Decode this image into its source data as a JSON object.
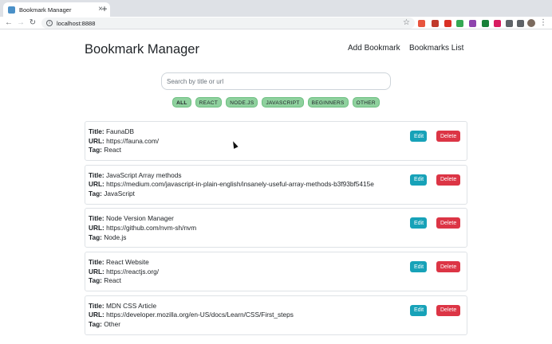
{
  "browser": {
    "tab_title": "Bookmark Manager",
    "tab_close": "×",
    "new_tab": "+",
    "url": "localhost:8888",
    "back": "←",
    "forward": "→",
    "reload": "↻",
    "star": "☆",
    "menu": "⋮",
    "info": "i",
    "extension_colors": [
      "#e8553e",
      "#c0392b",
      "#d93025",
      "#34a853",
      "#8e44ad",
      "#188038",
      "#d81b60",
      "#5f6368",
      "#5f6368"
    ]
  },
  "header": {
    "title": "Bookmark Manager",
    "add_link": "Add Bookmark",
    "list_link": "Bookmarks List"
  },
  "search": {
    "placeholder": "Search by title or url",
    "value": ""
  },
  "filters": [
    {
      "label": "ALL",
      "active": true
    },
    {
      "label": "REACT",
      "active": false
    },
    {
      "label": "NODE.JS",
      "active": false
    },
    {
      "label": "JAVASCRIPT",
      "active": false
    },
    {
      "label": "BEGINNERS",
      "active": false
    },
    {
      "label": "OTHER",
      "active": false
    }
  ],
  "labels": {
    "title": "Title:",
    "url": "URL:",
    "tag": "Tag:",
    "edit": "Edit",
    "delete": "Delete"
  },
  "bookmarks": [
    {
      "title": "FaunaDB",
      "url": "https://fauna.com/",
      "tag": "React"
    },
    {
      "title": "JavaScript Array methods",
      "url": "https://medium.com/javascript-in-plain-english/insanely-useful-array-methods-b3f93bf5415e",
      "tag": "JavaScript"
    },
    {
      "title": "Node Version Manager",
      "url": "https://github.com/nvm-sh/nvm",
      "tag": "Node.js"
    },
    {
      "title": "React Website",
      "url": "https://reactjs.org/",
      "tag": "React"
    },
    {
      "title": "MDN CSS Article",
      "url": "https://developer.mozilla.org/en-US/docs/Learn/CSS/First_steps",
      "tag": "Other"
    }
  ],
  "colors": {
    "chip_bg": "#8fd19e",
    "edit_button": "#17a2b8",
    "delete_button": "#dc3545"
  }
}
